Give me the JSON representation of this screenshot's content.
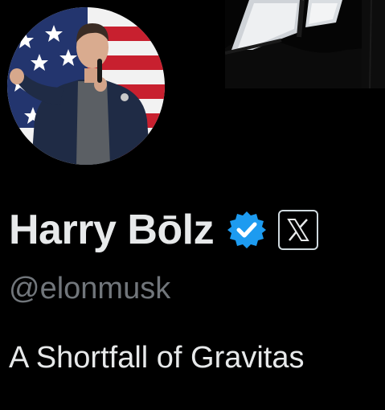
{
  "profile": {
    "display_name": "Harry Bōlz",
    "handle": "@elonmusk",
    "bio": "A Shortfall of Gravitas",
    "verified": true,
    "affiliate_badge_icon": "x-logo-icon",
    "avatar_description_icon": "profile-photo"
  },
  "colors": {
    "background": "#000000",
    "name_text": "#e7e9ea",
    "handle_text": "#71767b",
    "verified_blue": "#1d9bf0"
  }
}
